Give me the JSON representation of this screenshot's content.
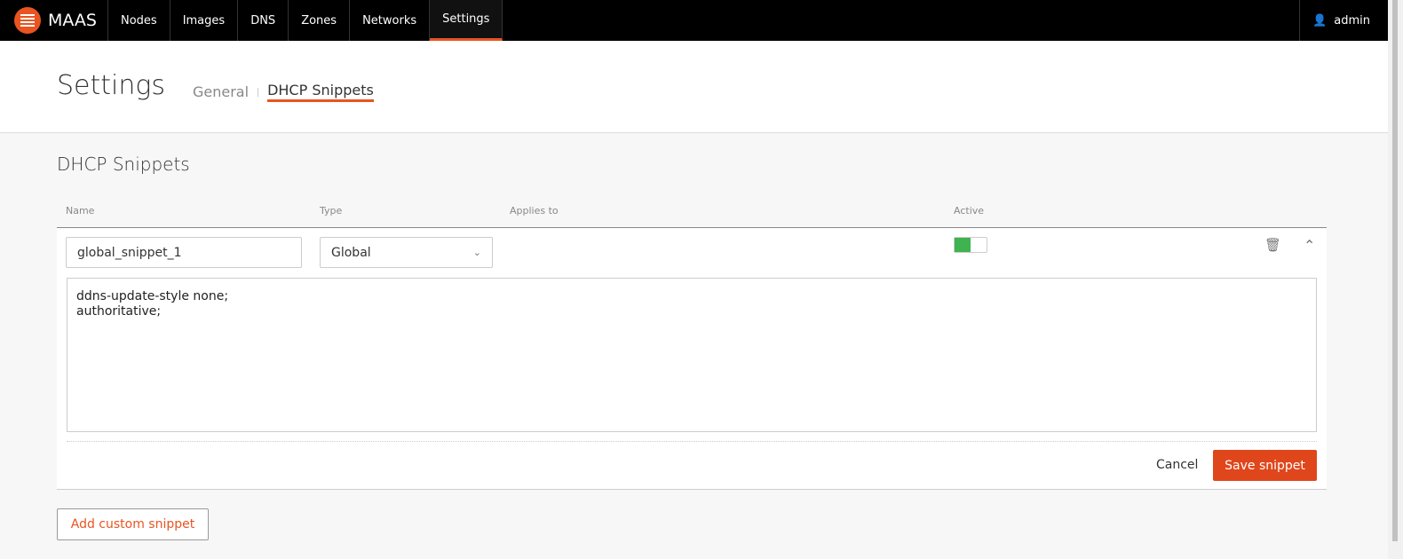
{
  "nav": {
    "brand": "MAAS",
    "items": [
      "Nodes",
      "Images",
      "DNS",
      "Zones",
      "Networks",
      "Settings"
    ],
    "active": "Settings",
    "user": "admin"
  },
  "header": {
    "title": "Settings",
    "tabs": [
      "General",
      "DHCP Snippets"
    ],
    "active_tab": "DHCP Snippets"
  },
  "section": {
    "title": "DHCP Snippets",
    "columns": [
      "Name",
      "Type",
      "Applies to",
      "Active"
    ]
  },
  "snippet": {
    "name": "global_snippet_1",
    "type": "Global",
    "active": true,
    "content": "ddns-update-style none;\nauthoritative;",
    "cancel_label": "Cancel",
    "save_label": "Save snippet"
  },
  "add_label": "Add custom snippet",
  "colors": {
    "accent": "#e95420",
    "toggle_on": "#3eb34f"
  }
}
